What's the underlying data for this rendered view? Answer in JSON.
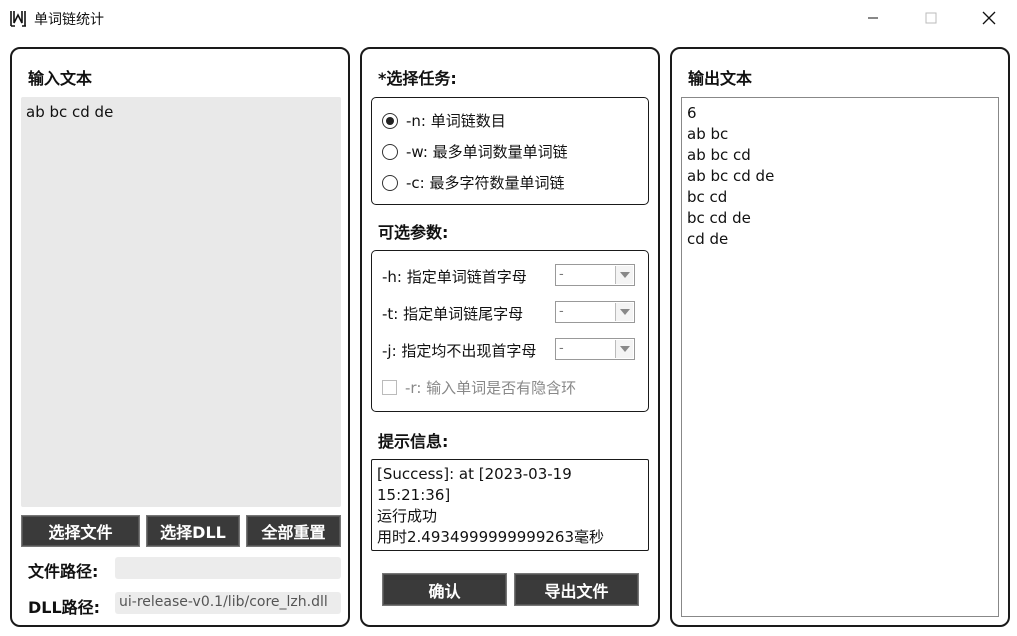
{
  "window": {
    "title": "单词链统计"
  },
  "input_panel": {
    "heading": "输入文本",
    "text": "ab bc cd de",
    "buttons": {
      "select_file": "选择文件",
      "select_dll": "选择DLL",
      "reset_all": "全部重置"
    },
    "file_path_label": "文件路径:",
    "file_path_value": "",
    "dll_path_label": "DLL路径:",
    "dll_path_value": "ui-release-v0.1/lib/core_lzh.dll"
  },
  "task_panel": {
    "heading": "*选择任务:",
    "tasks": [
      {
        "label": "-n: 单词链数目",
        "checked": true
      },
      {
        "label": "-w: 最多单词数量单词链",
        "checked": false
      },
      {
        "label": "-c: 最多字符数量单词链",
        "checked": false
      }
    ],
    "optional_heading": "可选参数:",
    "options": [
      {
        "label": "-h: 指定单词链首字母",
        "value": "-"
      },
      {
        "label": "-t: 指定单词链尾字母",
        "value": "-"
      },
      {
        "label": "-j: 指定均不出现首字母",
        "value": "-"
      }
    ],
    "loop_option": {
      "label": "-r: 输入单词是否有隐含环",
      "checked": false
    },
    "message_heading": "提示信息:",
    "messages": [
      "[Success]: at [2023-03-19 15:21:36]",
      "运行成功",
      "用时2.4934999999999263毫秒"
    ],
    "buttons": {
      "confirm": "确认",
      "export": "导出文件"
    }
  },
  "output_panel": {
    "heading": "输出文本",
    "lines": [
      "6",
      "ab bc",
      "ab bc cd",
      "ab bc cd de",
      "bc cd",
      "bc cd de",
      "cd de"
    ]
  },
  "colors": {
    "button_bg": "#3a3a3a",
    "input_bg": "#e9e9e9",
    "border": "#1a1a1a"
  }
}
